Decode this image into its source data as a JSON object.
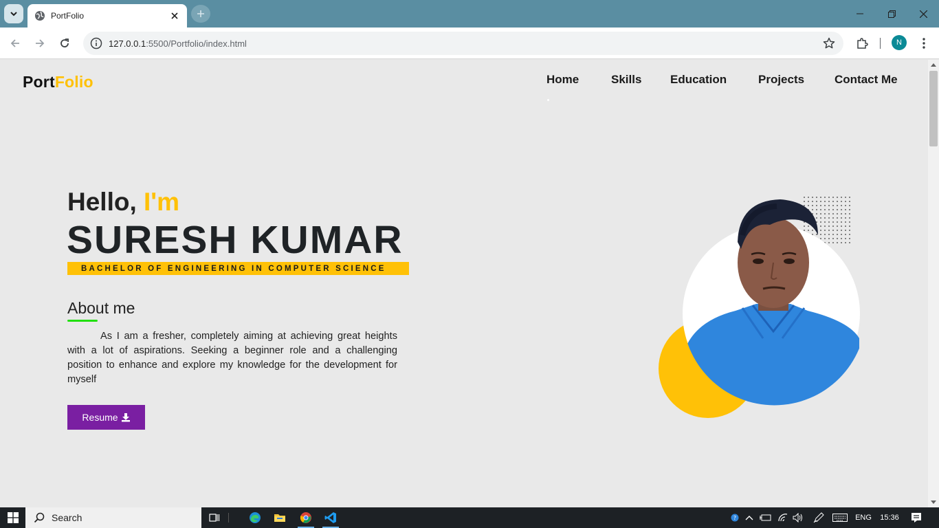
{
  "browser": {
    "tab_title": "PortFolio",
    "url_host": "127.0.0.1",
    "url_rest": ":5500/Portfolio/index.html",
    "profile_initial": "N"
  },
  "site": {
    "logo_primary": "Port",
    "logo_accent": "Folio",
    "nav": [
      "Home",
      "Skills",
      "Education",
      "Projects",
      "Contact Me"
    ],
    "greeting": "Hello, ",
    "greeting_accent": "I'm",
    "name": "SURESH KUMAR",
    "degree": "BACHELOR OF ENGINEERING IN COMPUTER SCIENCE",
    "about_title": "About me",
    "about_text": "As I am a fresher, completely aiming at achieving great heights with a lot of aspirations. Seeking a beginner role and a challenging position to enhance and explore my knowledge for the development for myself",
    "resume_label": "Resume"
  },
  "taskbar": {
    "search_label": "Search",
    "language": "ENG",
    "time": "15:36"
  },
  "colors": {
    "accent_yellow": "#ffc107",
    "button_purple": "#7a1fa2",
    "underline_green": "#22e010",
    "tab_bar": "#5a8ea2"
  }
}
